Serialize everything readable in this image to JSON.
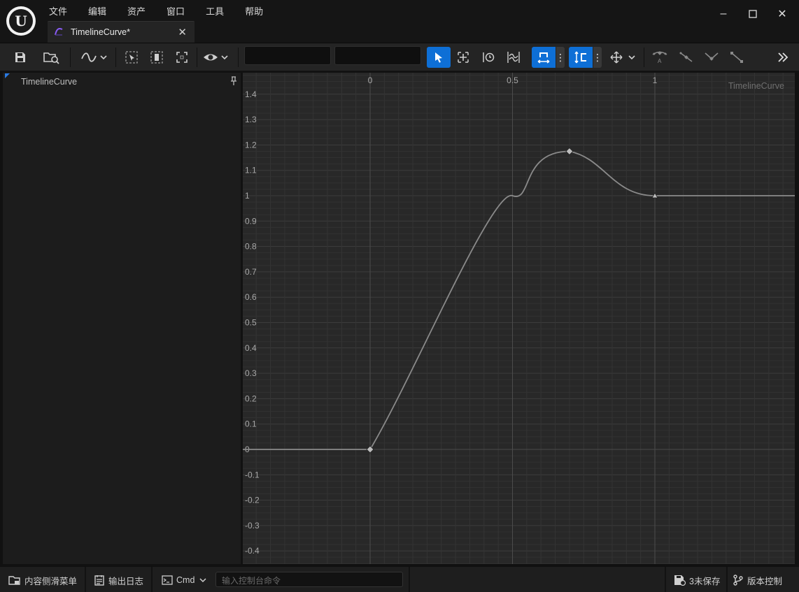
{
  "app": {
    "logo_text": "U"
  },
  "menu": [
    "文件",
    "编辑",
    "资产",
    "窗口",
    "工具",
    "帮助"
  ],
  "window_controls": {
    "minimize": "–",
    "maximize": "☐",
    "close": "✕"
  },
  "tab": {
    "title": "TimelineCurve*",
    "close": "✕"
  },
  "toolbar": {
    "buttons": [
      "save-icon",
      "browse-asset-icon",
      "curve-view-icon",
      "select-frame-icon",
      "select-key-icon",
      "frame-all-icon",
      "visibility-icon",
      "select-tool-icon",
      "transform-tool-icon",
      "retime-tool-icon",
      "multi-scale-tool-icon",
      "snap-time-icon",
      "snap-value-icon",
      "axis-snap-icon",
      "flatten-tangent-icon",
      "straighten-tangent-icon",
      "break-tangent-icon",
      "unify-tangent-icon",
      "more-icon"
    ],
    "time_input": "",
    "value_input": ""
  },
  "left_panel": {
    "curve_name": "TimelineCurve"
  },
  "graph": {
    "label": "TimelineCurve",
    "x_ticks": [
      "0",
      "0.5",
      "1"
    ],
    "y_ticks": [
      "1.4",
      "1.3",
      "1.2",
      "1.1",
      "1",
      "0.9",
      "0.8",
      "0.7",
      "0.6",
      "0.5",
      "0.4",
      "0.3",
      "0.2",
      "0.1",
      "0",
      "-0.1",
      "-0.2",
      "-0.3",
      "-0.4"
    ]
  },
  "chart_data": {
    "type": "line",
    "series": [
      {
        "name": "TimelineCurve",
        "x": [
          0,
          0.7,
          1
        ],
        "y": [
          0,
          1.175,
          1
        ]
      }
    ],
    "keys": [
      {
        "time": 0,
        "value": 0
      },
      {
        "time": 0.7,
        "value": 1.175
      },
      {
        "time": 1,
        "value": 1
      }
    ],
    "xlim": [
      -0.45,
      1.5
    ],
    "ylim": [
      -0.45,
      1.45
    ],
    "grid": true
  },
  "status": {
    "content_drawer": "内容侧滑菜单",
    "output_log": "输出日志",
    "cmd": "Cmd",
    "cmd_placeholder": "输入控制台命令",
    "unsaved": "3未保存",
    "source_control": "版本控制"
  }
}
